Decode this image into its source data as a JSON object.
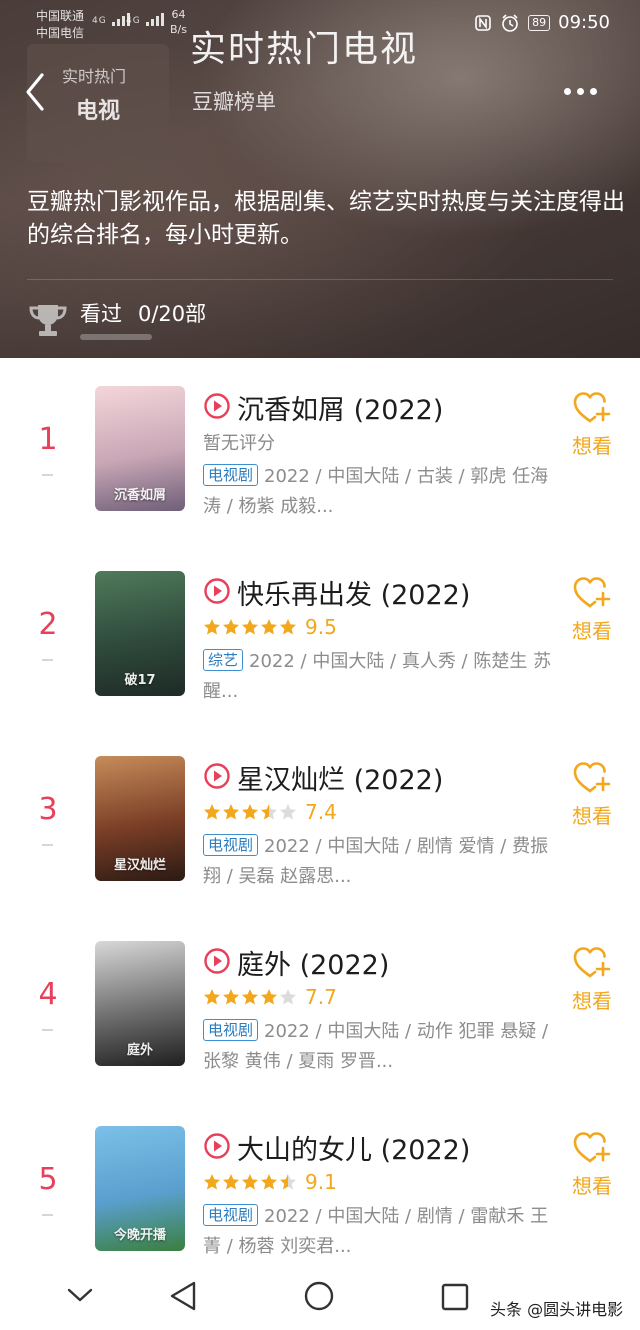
{
  "status_bar": {
    "carrier_1": "中国联通",
    "carrier_2": "中国电信",
    "network_1": "4G",
    "network_2": "4G",
    "net_speed_value": "64",
    "net_speed_unit": "B/s",
    "battery": "89",
    "time": "09:50"
  },
  "header": {
    "back_small": "实时热门",
    "back_big": "电视",
    "title": "实时热门电视",
    "subtitle": "豆瓣榜单",
    "description": "豆瓣热门影视作品，根据剧集、综艺实时热度与关注度得出的综合排名，每小时更新。",
    "watched_label": "看过",
    "watched_count": "0/20部",
    "watched_progress": 0
  },
  "colors": {
    "rank": "#e8405a",
    "accent": "#f2a71c",
    "tag_border": "#3c8fd0"
  },
  "items": [
    {
      "rank": "1",
      "title": "沉香如屑 (2022)",
      "rating_text": "暂无评分",
      "stars": null,
      "score": "",
      "tag": "电视剧",
      "info": "2022 / 中国大陆 / 古装 / 郭虎 任海涛 / 杨紫 成毅...",
      "want_label": "想看",
      "poster_text": "沉香如屑",
      "poster_colors": [
        "#f3d6da",
        "#c9a7b6",
        "#6f5f78"
      ]
    },
    {
      "rank": "2",
      "title": "快乐再出发 (2022)",
      "rating_text": "",
      "stars": 5,
      "score": "9.5",
      "tag": "综艺",
      "info": "2022 / 中国大陆 / 真人秀 / 陈楚生 苏醒...",
      "want_label": "想看",
      "poster_text": "破17",
      "poster_colors": [
        "#4f7a5a",
        "#2f4a3c",
        "#1e2a26"
      ]
    },
    {
      "rank": "3",
      "title": "星汉灿烂 (2022)",
      "rating_text": "",
      "stars": 3.5,
      "score": "7.4",
      "tag": "电视剧",
      "info": "2022 / 中国大陆 / 剧情 爱情 / 费振翔 / 吴磊 赵露思...",
      "want_label": "想看",
      "poster_text": "星汉灿烂",
      "poster_colors": [
        "#c78c5a",
        "#7a3e26",
        "#2b1a14"
      ]
    },
    {
      "rank": "4",
      "title": "庭外 (2022)",
      "rating_text": "",
      "stars": 4,
      "score": "7.7",
      "tag": "电视剧",
      "info": "2022 / 中国大陆 / 动作 犯罪 悬疑 / 张黎 黄伟 / 夏雨 罗晋...",
      "want_label": "想看",
      "poster_text": "庭外",
      "poster_colors": [
        "#d8d8d8",
        "#6f6f6f",
        "#1f1f1f"
      ]
    },
    {
      "rank": "5",
      "title": "大山的女儿 (2022)",
      "rating_text": "",
      "stars": 4.5,
      "score": "9.1",
      "tag": "电视剧",
      "info": "2022 / 中国大陆 / 剧情 / 雷献禾 王菁 / 杨蓉 刘奕君...",
      "want_label": "想看",
      "poster_text": "今晚开播",
      "poster_colors": [
        "#7cc0e8",
        "#5aa0cf",
        "#3b7f3e"
      ]
    }
  ],
  "watermark": "头条 @圆头讲电影"
}
